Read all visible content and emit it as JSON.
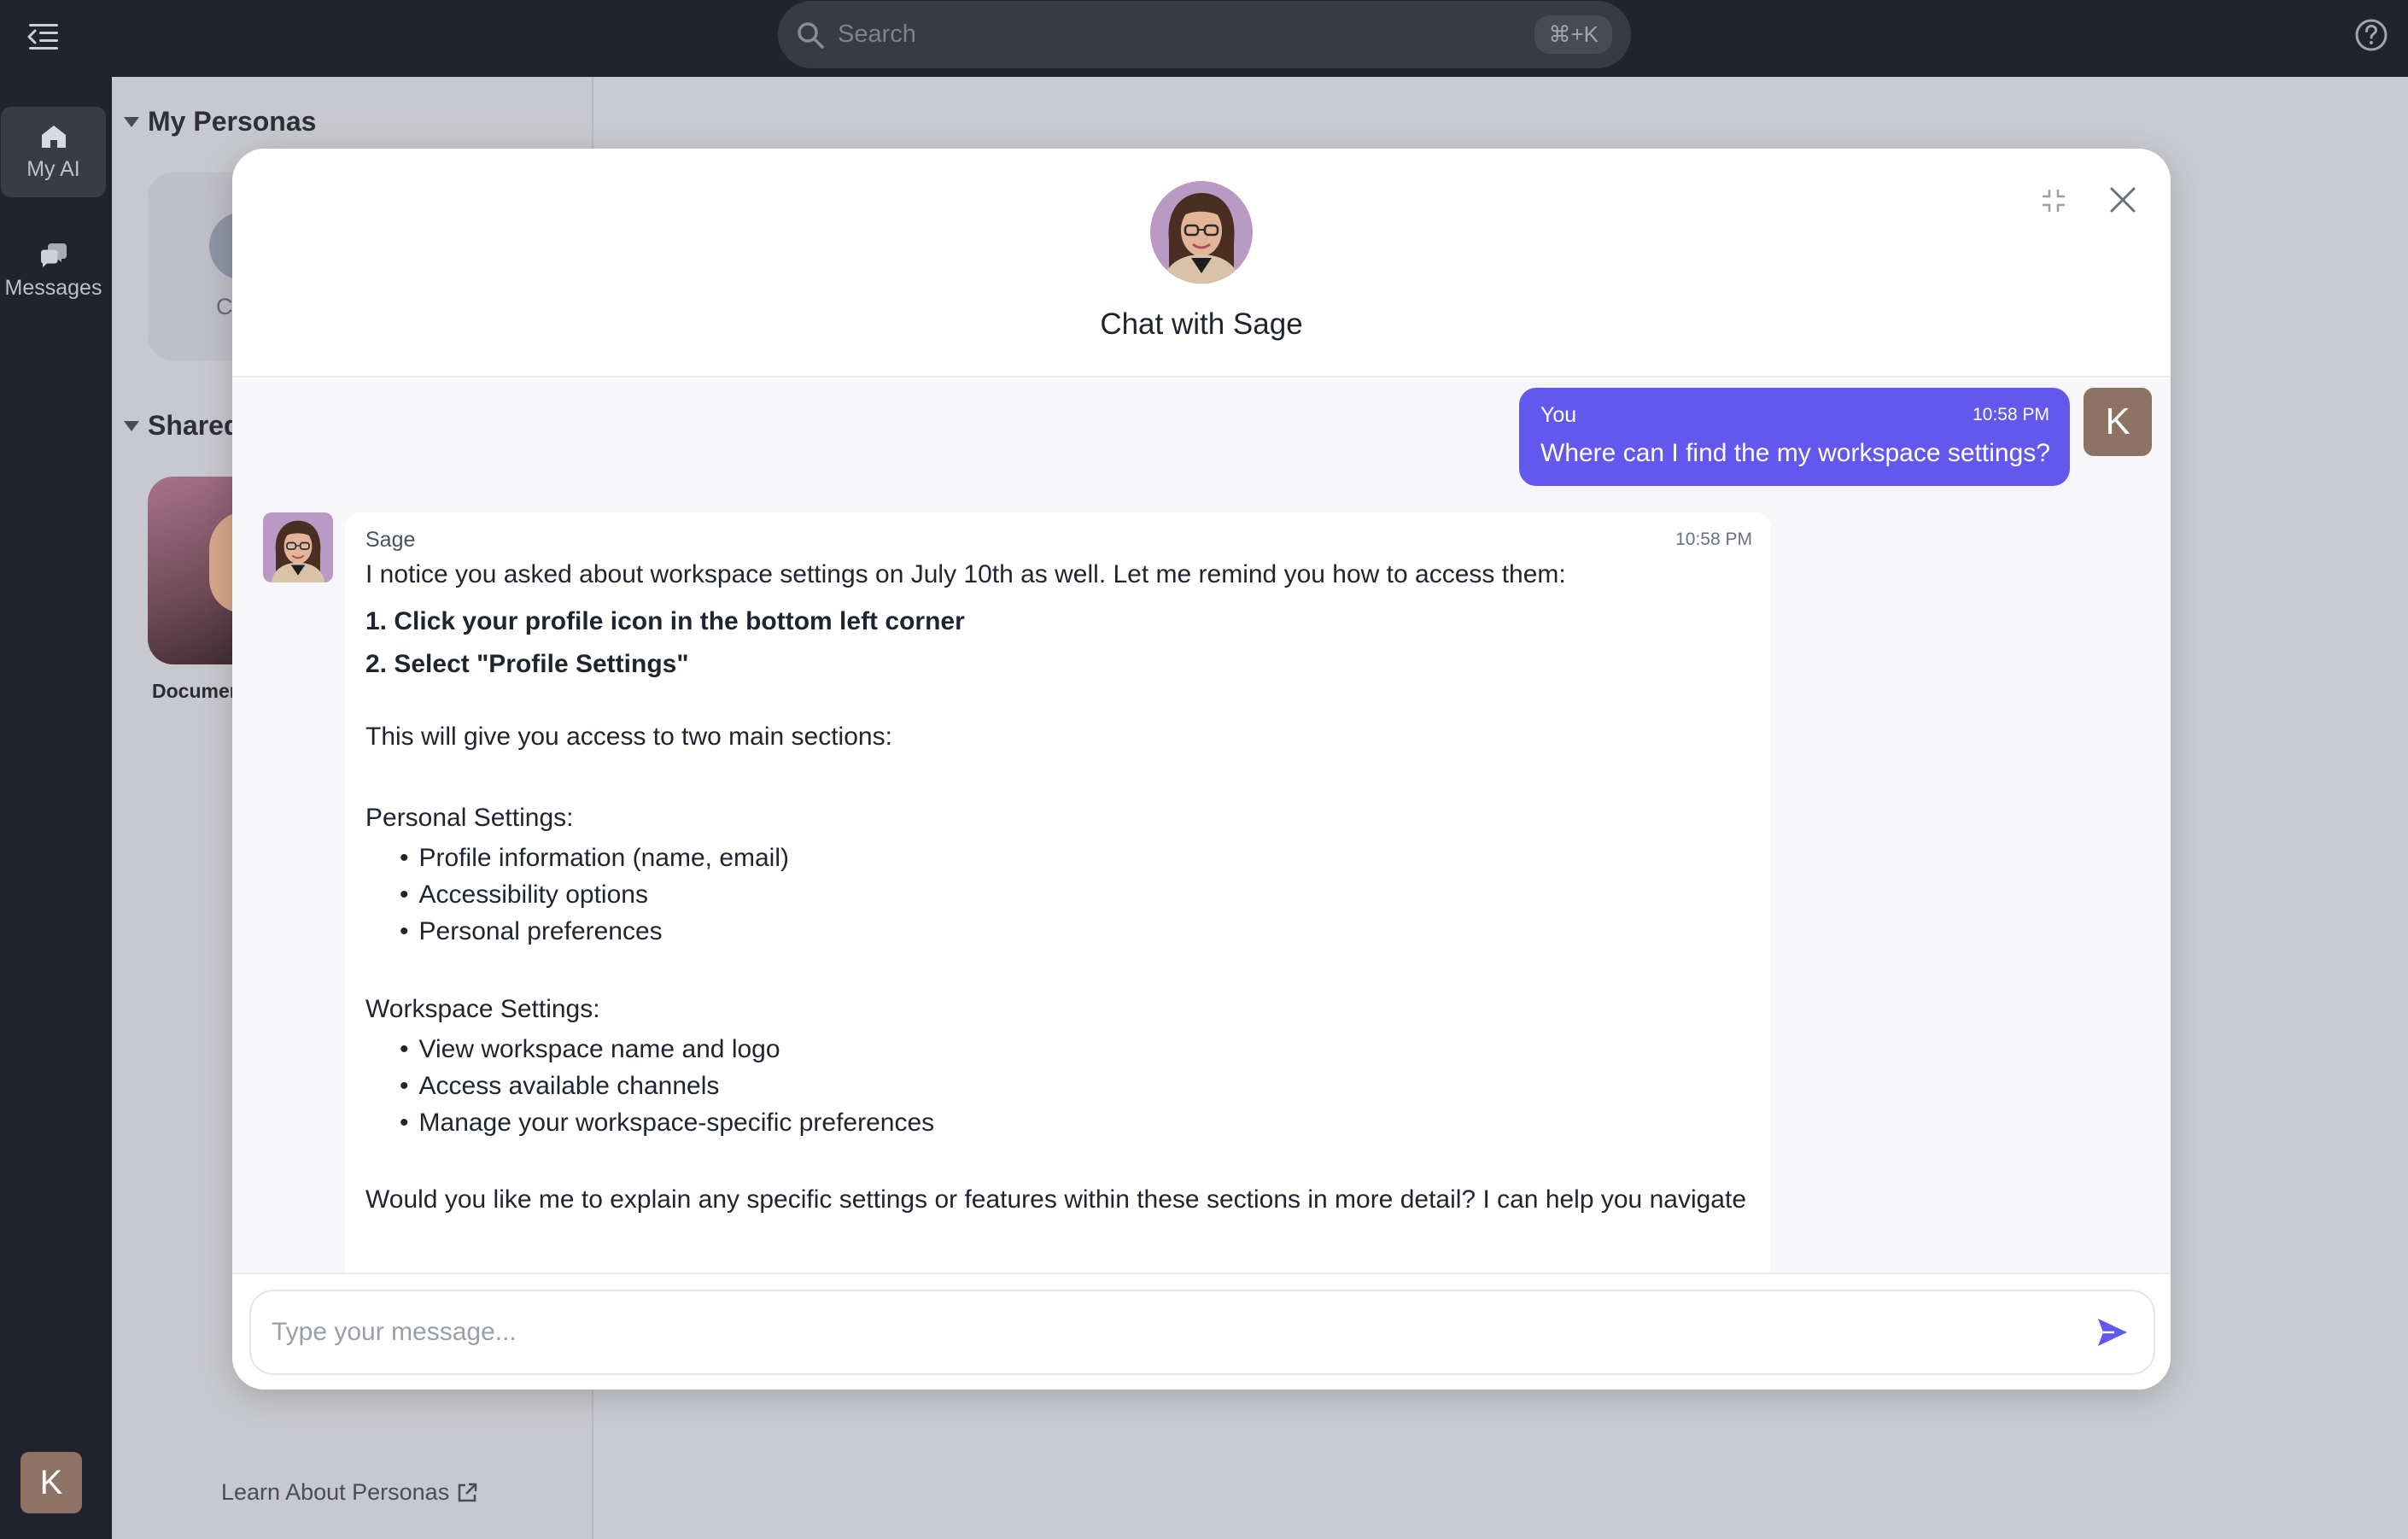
{
  "colors": {
    "topbar_bg": "#23232f",
    "accent": "#6358ee",
    "user_avatar": "#8e7264"
  },
  "topbar": {
    "search_placeholder": "Search",
    "search_shortcut": "⌘+K",
    "menu_icon": "collapse-menu-icon",
    "help_icon": "help-circle-icon"
  },
  "rail": {
    "items": [
      {
        "label": "My AI",
        "icon": "home-icon",
        "active": true
      },
      {
        "label": "Messages",
        "icon": "messages-icon",
        "active": false
      }
    ],
    "user_initial": "K"
  },
  "panel": {
    "my_personas_title": "My Personas",
    "create_label": "Crea",
    "shared_title": "Shared",
    "doc_card_label": "Documen",
    "learn_link": "Learn About Personas"
  },
  "modal": {
    "title": "Chat with Sage",
    "composer_placeholder": "Type your message..."
  },
  "messages": {
    "user": {
      "name": "You",
      "time": "10:58 PM",
      "text": "Where can I find the my workspace settings?",
      "initial": "K"
    },
    "sage": {
      "name": "Sage",
      "time": "10:58 PM",
      "intro": "I notice you asked about workspace settings on July 10th as well. Let me remind you how to access them:",
      "step1": "1.  Click your profile icon in the bottom left corner",
      "step2": "2.  Select \"Profile Settings\"",
      "access": "This will give you access to two main sections:",
      "personal_title": "Personal Settings:",
      "personal_items": [
        "Profile information (name, email)",
        "Accessibility options",
        "Personal preferences"
      ],
      "workspace_title": "Workspace Settings:",
      "workspace_items": [
        "View workspace name and logo",
        "Access available channels",
        "Manage your workspace-specific preferences"
      ],
      "closing": "Would you like me to explain any specific settings or features within these sections in more detail? I can help you navigate"
    }
  }
}
